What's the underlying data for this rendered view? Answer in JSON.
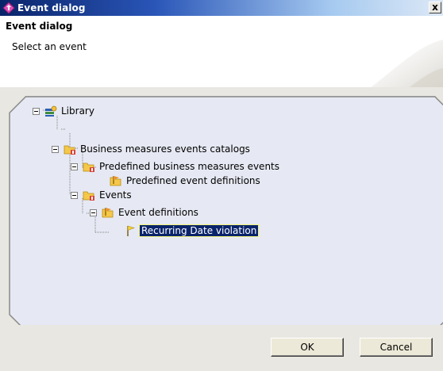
{
  "window": {
    "title": "Event dialog",
    "close_glyph": "x",
    "icon": "event-dialog-icon"
  },
  "header": {
    "title": "Event dialog",
    "description": "Select an event"
  },
  "tree": {
    "nodes": [
      {
        "label": "Library",
        "icon": "library-icon",
        "level": 0,
        "expanded": true
      },
      {
        "label": "Business measures events catalogs",
        "icon": "catalog-folder-icon",
        "level": 1,
        "expanded": true
      },
      {
        "label": "Predefined business measures events",
        "icon": "catalog-folder-icon",
        "level": 2,
        "expanded": true
      },
      {
        "label": "Predefined event definitions",
        "icon": "event-definitions-folder-icon",
        "level": 3
      },
      {
        "label": "Events",
        "icon": "catalog-folder-icon",
        "level": 2,
        "expanded": true
      },
      {
        "label": "Event definitions",
        "icon": "event-definitions-folder-icon",
        "level": 3,
        "expanded": true
      },
      {
        "label": "Recurring Date violation",
        "icon": "flag-icon",
        "level": 4,
        "selected": true
      }
    ]
  },
  "buttons": {
    "ok": "OK",
    "cancel": "Cancel"
  },
  "colors": {
    "selection": "#0a246a",
    "titlebar": "#0a246a",
    "dialog_bg": "#e9e7e1"
  }
}
